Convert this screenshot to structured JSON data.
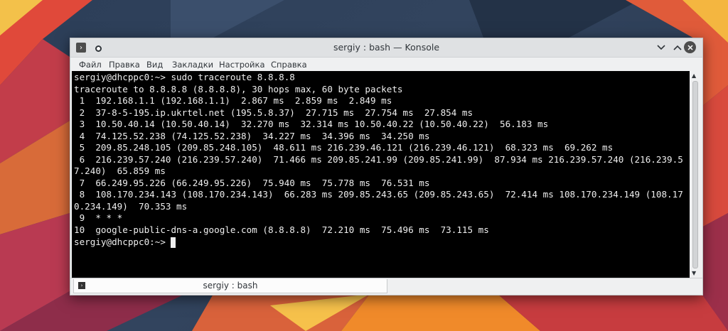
{
  "window": {
    "title": "sergiy : bash — Konsole",
    "controls": {
      "minimize_icon": "chevron-down-icon",
      "maximize_icon": "chevron-up-icon",
      "close_icon": "close-icon"
    }
  },
  "menu": [
    "Файл",
    "Правка",
    "Вид",
    "Закладки",
    "Настройка",
    "Справка"
  ],
  "terminal": {
    "lines": [
      "sergiy@dhcppc0:~> sudo traceroute 8.8.8.8",
      "traceroute to 8.8.8.8 (8.8.8.8), 30 hops max, 60 byte packets",
      " 1  192.168.1.1 (192.168.1.1)  2.867 ms  2.859 ms  2.849 ms",
      " 2  37-8-5-195.ip.ukrtel.net (195.5.8.37)  27.715 ms  27.754 ms  27.854 ms",
      " 3  10.50.40.14 (10.50.40.14)  32.270 ms  32.314 ms 10.50.40.22 (10.50.40.22)  56.183 ms",
      " 4  74.125.52.238 (74.125.52.238)  34.227 ms  34.396 ms  34.250 ms",
      " 5  209.85.248.105 (209.85.248.105)  48.611 ms 216.239.46.121 (216.239.46.121)  68.323 ms  69.262 ms",
      " 6  216.239.57.240 (216.239.57.240)  71.466 ms 209.85.241.99 (209.85.241.99)  87.934 ms 216.239.57.240 (216.239.5",
      "7.240)  65.859 ms",
      " 7  66.249.95.226 (66.249.95.226)  75.940 ms  75.778 ms  76.531 ms",
      " 8  108.170.234.143 (108.170.234.143)  66.283 ms 209.85.243.65 (209.85.243.65)  72.414 ms 108.170.234.149 (108.17",
      "0.234.149)  70.353 ms",
      " 9  * * *",
      "10  google-public-dns-a.google.com (8.8.8.8)  72.210 ms  75.496 ms  73.115 ms",
      "sergiy@dhcppc0:~> "
    ]
  },
  "tab": {
    "label": "sergiy : bash"
  },
  "colors": {
    "terminal_bg": "#000000",
    "terminal_fg": "#eeeeee",
    "chrome": "#eff0f1"
  }
}
